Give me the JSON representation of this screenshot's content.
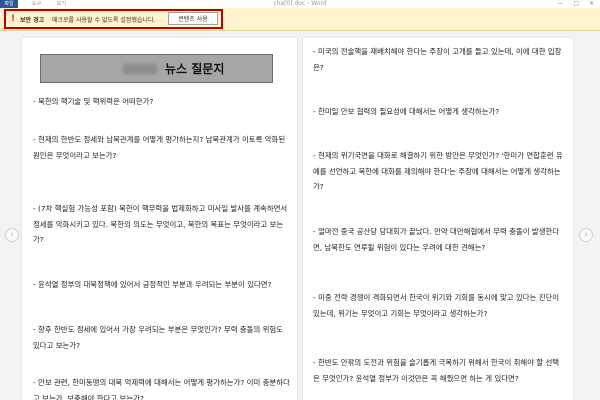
{
  "titlebar": {
    "app_badge": "파일",
    "menu": [
      "도구",
      "보기"
    ],
    "doc_title": "cha[0].doc - Word",
    "controls": [
      "—",
      "□",
      "✕"
    ]
  },
  "security_bar": {
    "title": "보안 경고",
    "message": "매크로를 사용할 수 없도록 설정했습니다.",
    "button_label": "콘텐츠 사용",
    "accent_color": "#c00000"
  },
  "document": {
    "heading": "뉴스 질문지",
    "left_questions": [
      "- 북한의 핵기술 및 핵위력은 어떠한가?",
      "- 현재의 한반도 정세와 남북관계를 어떻게 평가하는지? 남북관계가 이토록 악화된 원인은 무엇이라고 보는가?",
      "- (7차 핵실험 가능성 포함) 북한이 핵무력을 법제화하고 미사일 발사를 계속하면서 정세를 악화시키고 있다. 북한의 의도는 무엇이고, 북한의 목표는 무엇이라고 보는가?",
      "- 윤석열 정부의 대북정책에 있어서 긍정적인 부분과 우려되는 부분이 있다면?",
      "- 향후 한반도 정세에 있어서 가장 우려되는 부분은 무엇인가? 무력 충돌의 위험도 있다고 보는가?",
      "- 안보 관련, 한미동맹의 대북 억제력에 대해서는 어떻게 평가하는가? 이미 충분하다고 보는가, 보충해야 한다고 보는가?"
    ],
    "right_questions": [
      "- 미국의 전술핵을 재배치해야 한다는 주장이 고개를 들고 있는데, 이에 대한 입장은?",
      "- 한미일 안보 협력의 필요성에 대해서는 어떻게 생각하는가?",
      "- 현재의 위기국면을 대화로 해결하기 위한 방안은 무엇인가? '한미가 연합훈련 유예를 선언하고 북한에 대화를 제의해야 한다'는 주장에 대해서는 어떻게 생각하는가?",
      "- 얼마전 중국 공산당 당대회가 끝났다. 만약 대만해협에서 무력 충돌이 발생한다면, 남북한도 연루될 위험이 있다는 우려에 대한 견해는?",
      "- 미중 전략 경쟁이 격화되면서 한국이 위기와 기회를 동시에 맞고 있다는 진단이 있는데, 위기는 무엇이고 기회는 무엇이라고 생각하는가?",
      "- 한반도 안팎의 도전과 위험을 슬기롭게 극복하기 위해서 한국이 취해야 할 선택은 무엇인가? 윤석열 정부가 이것만은 꼭 해줬으면 하는 게 있다면?"
    ]
  },
  "nav": {
    "prev": "‹",
    "next": "›"
  }
}
